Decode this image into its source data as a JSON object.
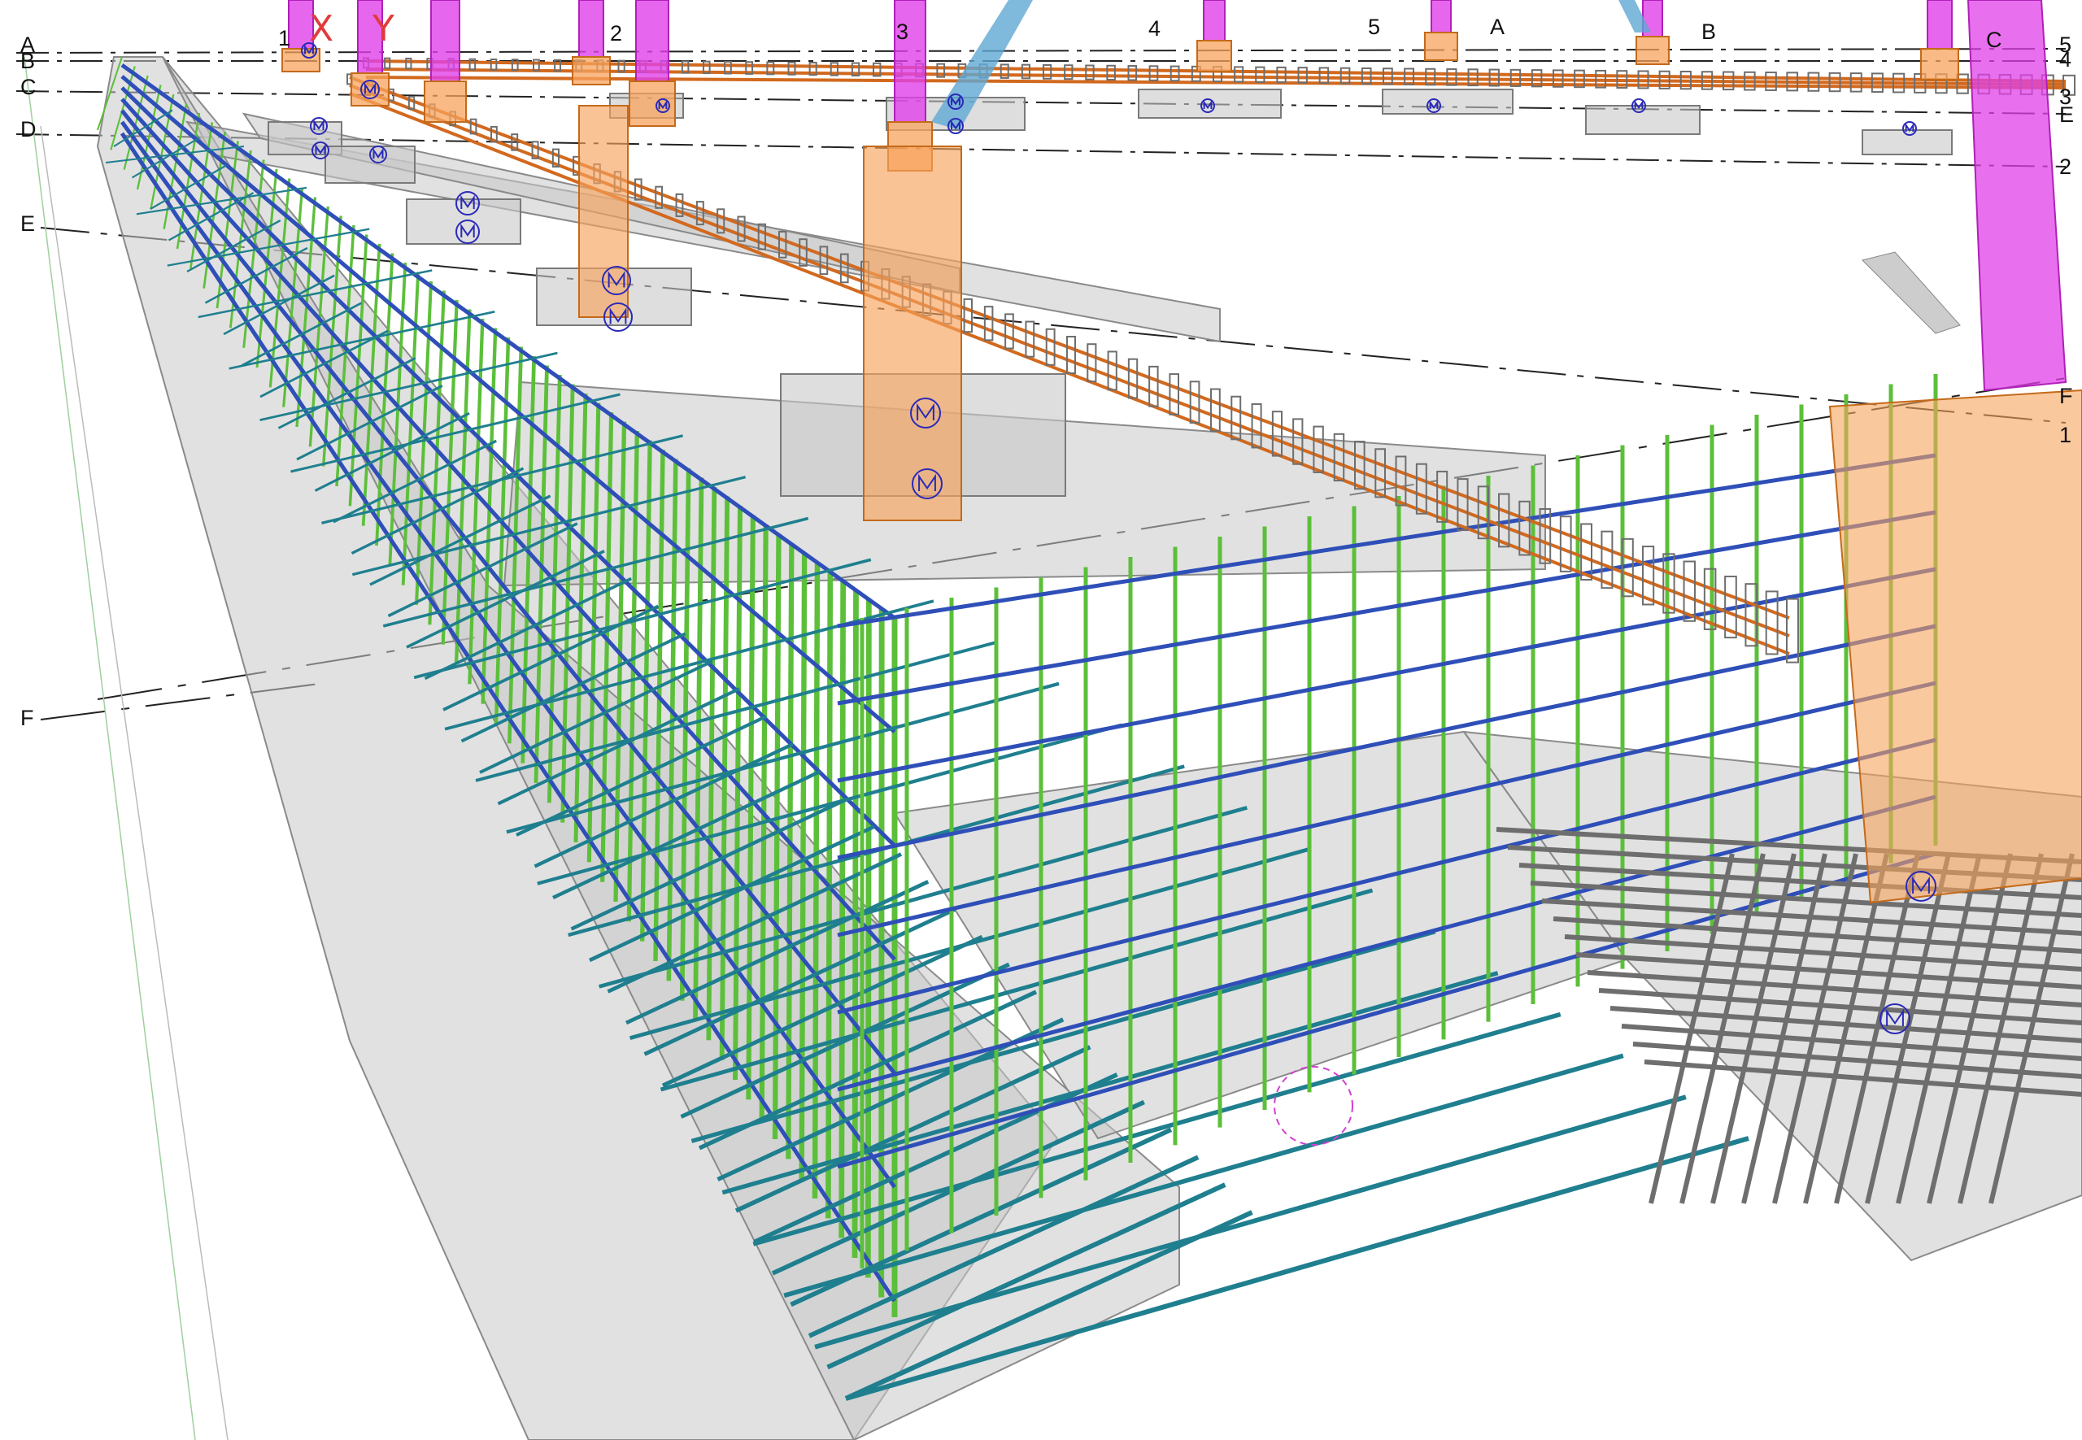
{
  "view": {
    "axis_labels": {
      "x": "X",
      "y": "Y"
    },
    "grid_labels": {
      "left": [
        "A",
        "B",
        "C",
        "D",
        "E",
        "F"
      ],
      "top_numbers": [
        "1",
        "2",
        "3",
        "4",
        "5"
      ],
      "top_letters": [
        "A",
        "B",
        "C"
      ],
      "right": [
        "5",
        "4",
        "3",
        "E",
        "2",
        "F",
        "1"
      ]
    }
  },
  "colors": {
    "background": "#ffffff",
    "steel_column": "#e040e8",
    "pedestal": "#f7a35c",
    "rebar_green": "#5cbf3a",
    "rebar_blue": "#2f4fb8",
    "rebar_teal": "#1f7f8f",
    "rebar_orange": "#d2691e",
    "rebar_grey": "#6e6e6e",
    "concrete": "#c8c8c8",
    "brace": "#5fa8d3",
    "anchor_symbol": "#2a2ab8",
    "axis_label": "#e23b3b"
  }
}
